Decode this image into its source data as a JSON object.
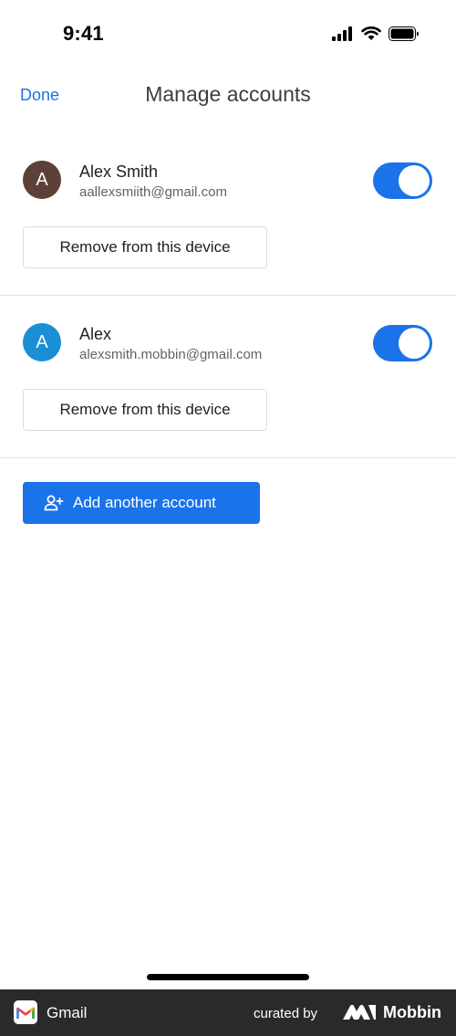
{
  "status_bar": {
    "time": "9:41",
    "icons": [
      "signal-icon",
      "wifi-icon",
      "battery-icon"
    ]
  },
  "header": {
    "done_label": "Done",
    "title": "Manage accounts"
  },
  "accounts": [
    {
      "initial": "A",
      "name": "Alex Smith",
      "email": "aallexsmiith@gmail.com",
      "avatar_color": "#5d4037",
      "sync_enabled": true,
      "remove_label": "Remove from this device"
    },
    {
      "initial": "A",
      "name": "Alex",
      "email": "alexsmith.mobbin@gmail.com",
      "avatar_color": "#1a8fd6",
      "sync_enabled": true,
      "remove_label": "Remove from this device"
    }
  ],
  "add_account": {
    "label": "Add another account",
    "icon": "add-person-icon"
  },
  "footer": {
    "app_name": "Gmail",
    "curated_label": "curated by",
    "brand": "Mobbin"
  },
  "colors": {
    "accent": "#1a73e8",
    "toggle_on": "#1a73e8",
    "divider": "#e2e3e6",
    "footer_bg": "#2a2a2a"
  }
}
